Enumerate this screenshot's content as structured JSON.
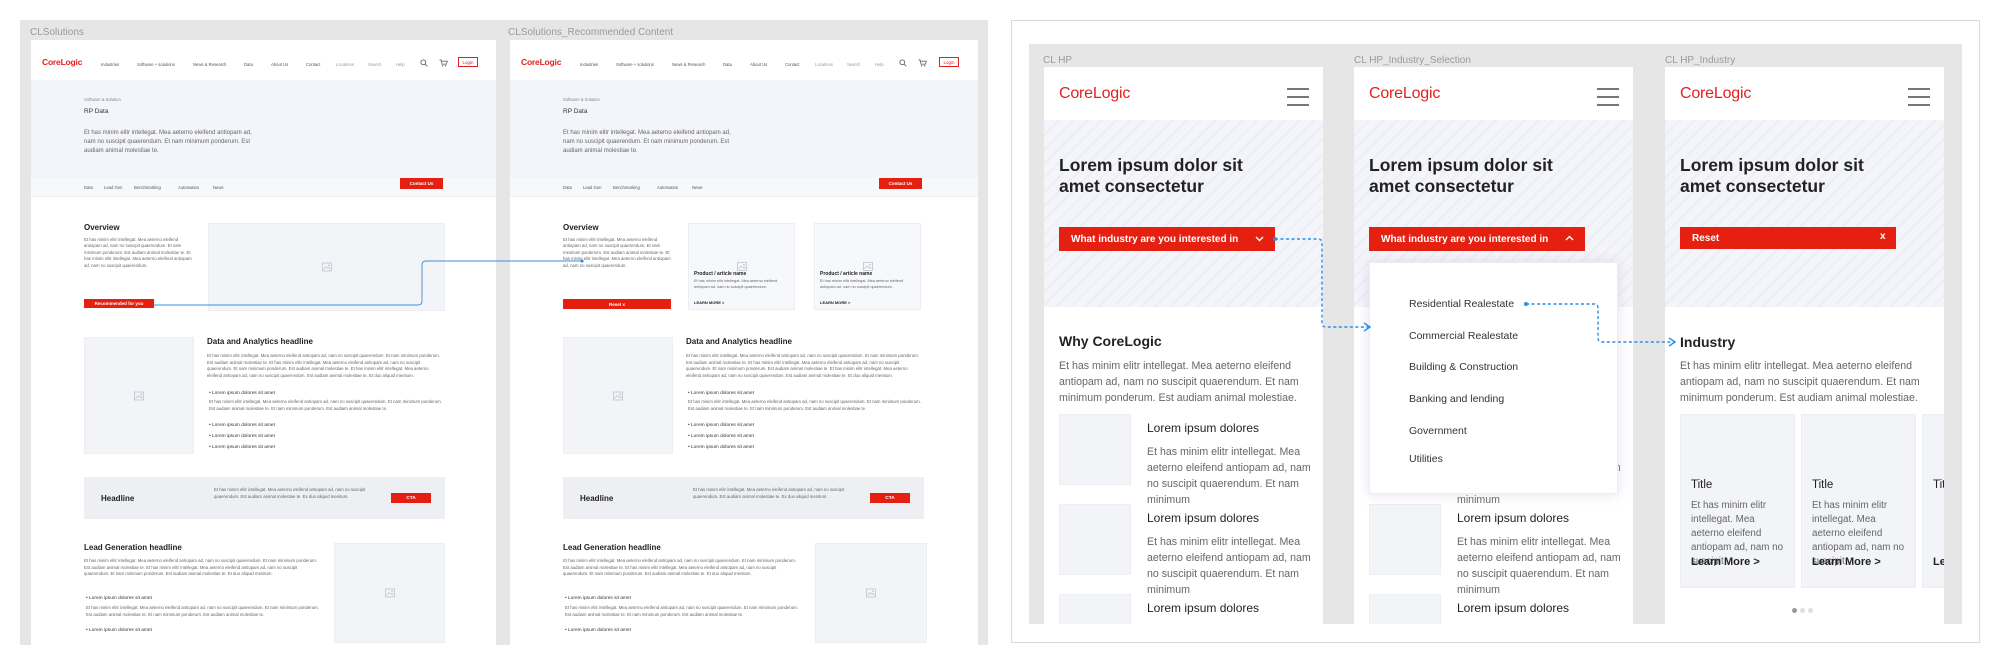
{
  "colors": {
    "accent": "#e52010",
    "link": "#2d8ee6"
  },
  "desktop": {
    "frames": [
      "CLSolutions",
      "CLSolutions_Recommended Content"
    ],
    "logo": "CoreLogic",
    "nav": [
      "Industries",
      "Software + solutions",
      "News & Research",
      "Data",
      "About Us",
      "Contact",
      "Locations",
      "Search",
      "Help"
    ],
    "login": "Login",
    "breadcrumb": "Software & Solution",
    "title": "RP Data",
    "intro": "Et has minim elitr intellegat. Mea aeterno eleifend antiopam ad, nam no suscipit quaerendum. Et nam minimum ponderum. Est audiam animal molestiae te.",
    "subnav": [
      "Data",
      "Lead Gen",
      "Benchmarking",
      "Automation",
      "News"
    ],
    "contact": "Contact Us",
    "overview": "Overview",
    "overview_text": "Et has minim elitr intellegat. Mea aeterno eleifend antiopam ad, nam no suscipit quaerendum. Et nam minimum ponderum. Est audiam animal molestiae te. Et has minim elitr intellegat. Mea aeterno eleifend antiopam ad, nam no suscipit quaerendum.",
    "recommended": "Recommended for you",
    "reset": "Reset x",
    "product_title": "Product / article name",
    "product_text": "Et has minim elitr intellegat. Mea aeterno eleifend antiopam ad, nam no suscipit quaerendum.",
    "learn_more": "LEARN MORE >",
    "analytics_h": "Data and Analytics headline",
    "analytics_text": "Et has minim elitr intellegat. Mea aeterno eleifend antiopam ad, nam no suscipit quaerendum. Et nam minimum ponderum. Est audiam animal molestiae te. Et has minim elitr intellegat. Mea aeterno eleifend antiopam ad, nam no suscipit quaerendum. Et nam minimum ponderum. Est audiam animal molestiae te. Et has minim elitr intellegat. Mea aeterno eleifend antiopam ad, nam no suscipit quaerendum. Est audiam animal molestiae te. Et duo aliquid menitum.",
    "bullet": "Lorem ipsum dolores sit amet",
    "bullet_text": "Et has minim elitr intellegat. Mea aeterno eleifend antiopam ad, nam no suscipit quaerendum. Et nam minimum ponderum. Est audiam animal molestiae te. Et nam minimum ponderum. Est audiam animal molestiae te.",
    "banner_h": "Headline",
    "banner_text": "Et has minim elitr intellegat. Mea aeterno eleifend antiopam ad, nam no suscipit quaerendum. Est audiam animal molestiae te. Ex duo aliquid menitum.",
    "cta": "CTA",
    "leadgen_h": "Lead Generation headline",
    "leadgen_text": "Et has minim elitr intellegat. Mea aeterno eleifend antiopam ad, nam no suscipit quaerendum. Et nam minimum ponderum. Est audiam animal molestiae te. Et has minim elitr intellegat. Mea aeterno eleifend antiopam ad, nam no suscipit quaerendum. Et nam minimum ponderum. Est audiam animal molestiae te. Et duo aliquid menitum.",
    "lead_bullet": "Lorem ipsum dolores sit amet"
  },
  "mobile": {
    "frames": [
      "CL HP",
      "CL HP_Industry_Selection",
      "CL HP_Industry"
    ],
    "logo": "CoreLogic",
    "hero": "Lorem ipsum dolor sit amet consectetur",
    "dropdown": "What industry are you interested in",
    "reset": "Reset",
    "reset_x": "x",
    "why": "Why CoreLogic",
    "why_text": "Et has minim elitr intellegat. Mea aeterno eleifend antiopam ad, nam no suscipit quaerendum. Et nam minimum ponderum. Est audiam animal molestiae.",
    "item_title": "Lorem ipsum dolores",
    "item_text": "Et has minim elitr intellegat. Mea aeterno eleifend antiopam ad, nam no suscipit quaerendum. Et nam minimum",
    "industries": [
      "Residential Realestate",
      "Commercial Realestate",
      "Building & Construction",
      "Banking and lending",
      "Government",
      "Utilities"
    ],
    "industry": "Industry",
    "card_title": "Title",
    "card_text": "Et has minim elitr intellegat. Mea aeterno eleifend antiopam ad, nam no suscipit",
    "learn_more": "Learn More >"
  }
}
